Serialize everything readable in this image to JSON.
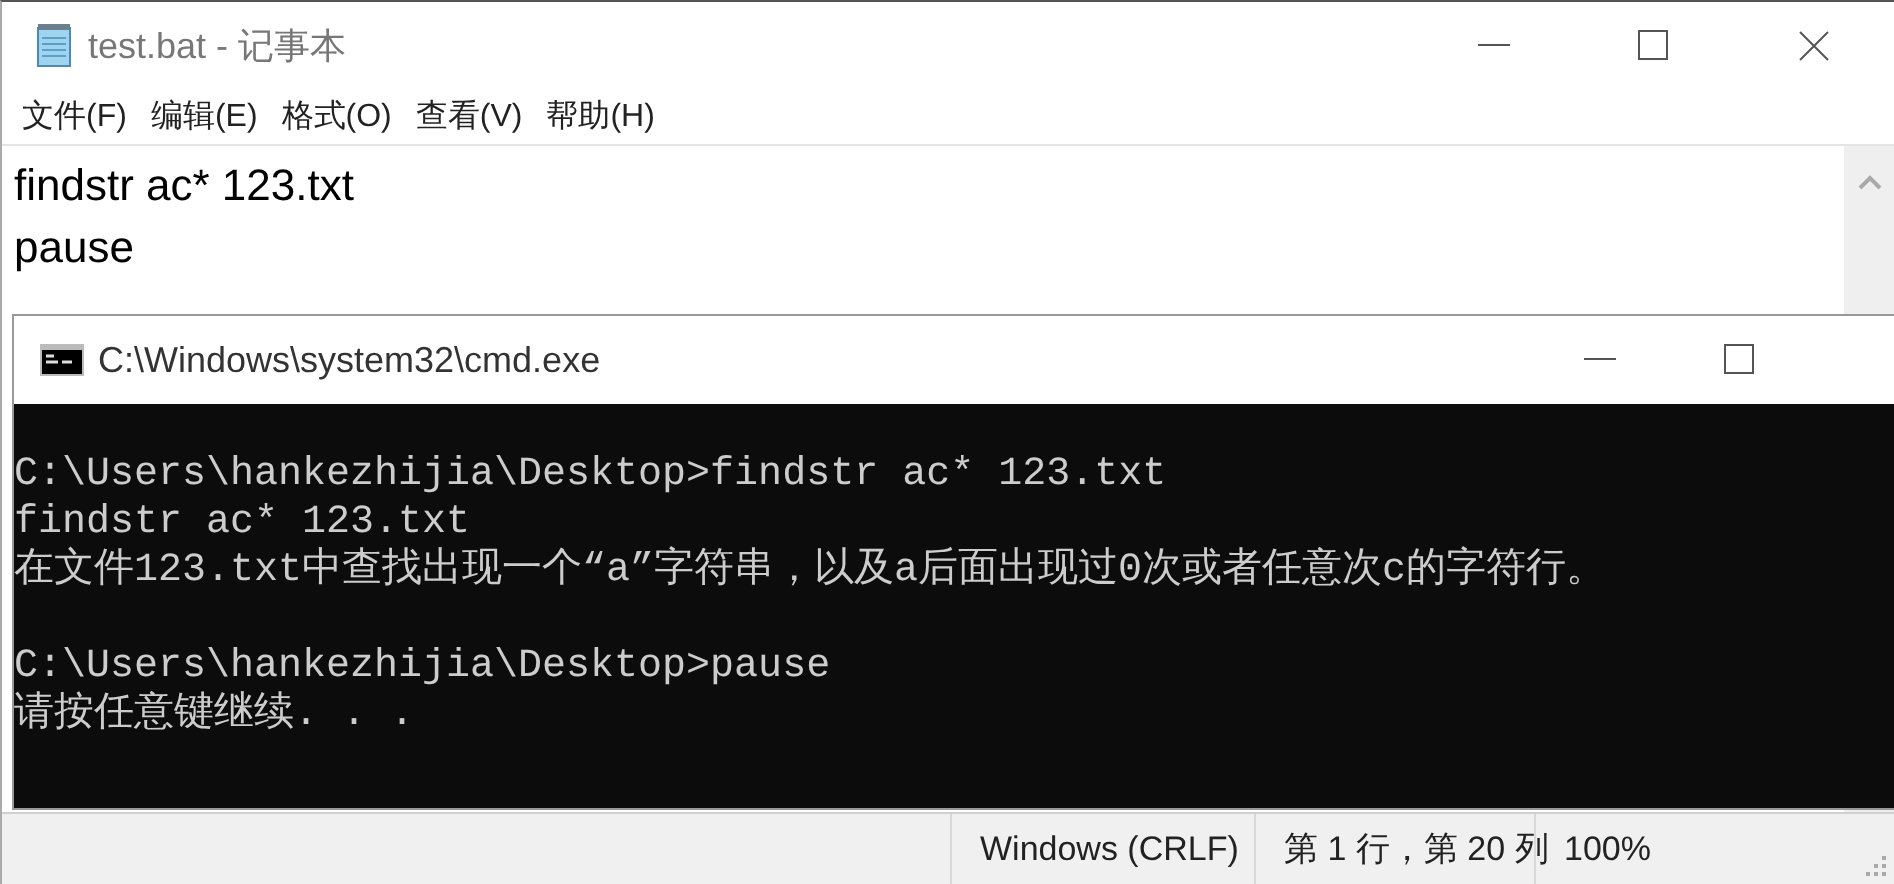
{
  "notepad": {
    "title": "test.bat - 记事本",
    "menu": [
      "文件(F)",
      "编辑(E)",
      "格式(O)",
      "查看(V)",
      "帮助(H)"
    ],
    "lines": [
      "findstr ac* 123.txt",
      "pause"
    ],
    "status_bar": [
      "Windows (CRLF)",
      "第 1 行，第 20 列",
      "100%"
    ]
  },
  "cmd": {
    "title": "C:\\Windows\\system32\\cmd.exe",
    "blocks": [
      [
        "C:\\Users\\hankezhijia\\Desktop>findstr ac* 123.txt",
        "findstr ac* 123.txt",
        "在文件123.txt中查找出现一个“a”字符串，以及a后面出现过0次或者任意次c的字符行。"
      ],
      [
        "C:\\Users\\hankezhijia\\Desktop>pause",
        "请按任意键继续. . ."
      ]
    ]
  }
}
